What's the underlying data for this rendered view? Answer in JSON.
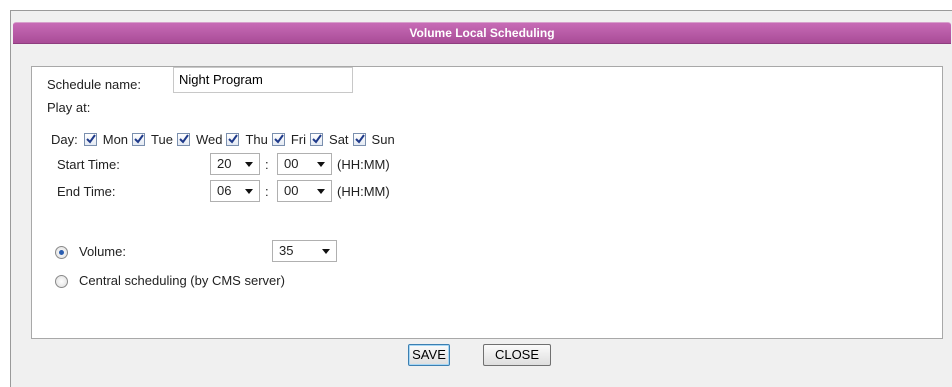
{
  "dialog": {
    "title": "Volume Local Scheduling"
  },
  "form": {
    "schedule_name_label": "Schedule name:",
    "schedule_name_value": "Night Program",
    "play_at_label": "Play at:",
    "day_label": "Day:",
    "days": [
      {
        "label": "Mon",
        "checked": true
      },
      {
        "label": "Tue",
        "checked": true
      },
      {
        "label": "Wed",
        "checked": true
      },
      {
        "label": "Thu",
        "checked": true
      },
      {
        "label": "Fri",
        "checked": true
      },
      {
        "label": "Sat",
        "checked": true
      },
      {
        "label": "Sun",
        "checked": true
      }
    ],
    "start_time": {
      "label": "Start Time:",
      "hour": "20",
      "minute": "00",
      "separator": ":",
      "format": "(HH:MM)"
    },
    "end_time": {
      "label": "End Time:",
      "hour": "06",
      "minute": "00",
      "separator": ":",
      "format": "(HH:MM)"
    },
    "volume_option": {
      "label": "Volume:",
      "selected": true,
      "value": "35"
    },
    "central_option": {
      "label": "Central scheduling (by CMS server)",
      "selected": false
    }
  },
  "buttons": {
    "save": "SAVE",
    "close": "CLOSE"
  },
  "colors": {
    "title_bar": "#b556a4",
    "panel_border": "#a8a8a8",
    "dialog_bg": "#f0f0f0"
  }
}
